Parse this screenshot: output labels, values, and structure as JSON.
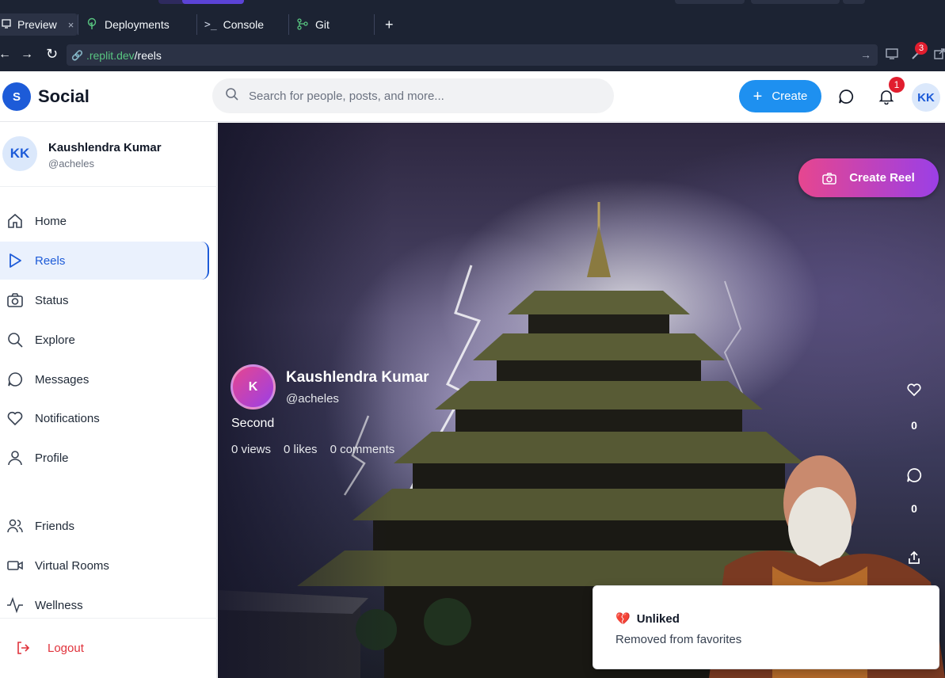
{
  "browser": {
    "tabs": [
      {
        "label": "Preview",
        "icon": "monitor-icon",
        "active": true
      },
      {
        "label": "Deployments",
        "icon": "deploy-icon"
      },
      {
        "label": "Console",
        "icon": "terminal-icon"
      },
      {
        "label": "Git",
        "icon": "git-icon"
      }
    ],
    "new_tab": "+",
    "close": "×",
    "url_domain": ".replit.dev",
    "url_path": "/reels",
    "devtools_badge": "3"
  },
  "app": {
    "logo_letter": "S",
    "logo_text": "Social",
    "search_placeholder": "Search for people, posts, and more...",
    "create_label": "Create",
    "notification_count": "1",
    "avatar_initials": "KK",
    "brand_color": "#1d5bd8"
  },
  "sidebar": {
    "user": {
      "initials": "KK",
      "name": "Kaushlendra Kumar",
      "handle": "@acheles"
    },
    "items": [
      {
        "label": "Home",
        "icon": "home-icon"
      },
      {
        "label": "Reels",
        "icon": "play-icon",
        "active": true
      },
      {
        "label": "Status",
        "icon": "camera-icon"
      },
      {
        "label": "Explore",
        "icon": "search-icon"
      },
      {
        "label": "Messages",
        "icon": "message-icon"
      },
      {
        "label": "Notifications",
        "icon": "heart-icon"
      },
      {
        "label": "Profile",
        "icon": "user-icon"
      },
      {
        "label": "Friends",
        "icon": "users-icon"
      },
      {
        "label": "Virtual Rooms",
        "icon": "video-icon"
      },
      {
        "label": "Wellness",
        "icon": "activity-icon"
      }
    ],
    "logout_label": "Logout"
  },
  "reel": {
    "create_reel_label": "Create Reel",
    "author_initial": "K",
    "author_name": "Kaushlendra Kumar",
    "author_handle": "@acheles",
    "caption": "Second",
    "views": "0 views",
    "likes": "0 likes",
    "comments": "0 comments",
    "like_count": "0",
    "comment_count": "0"
  },
  "toast": {
    "title": "Unliked",
    "description": "Removed from favorites"
  }
}
